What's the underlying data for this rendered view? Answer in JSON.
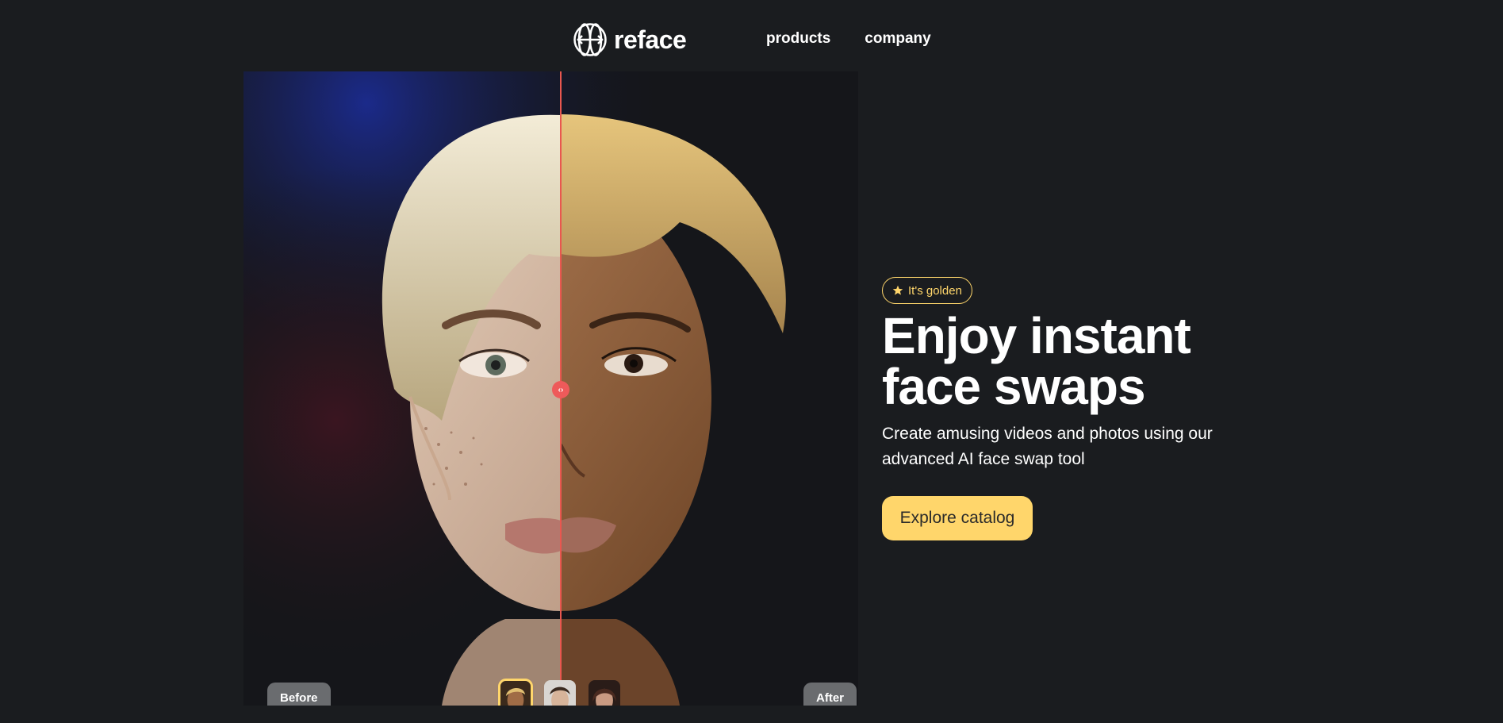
{
  "brand": {
    "name": "reface",
    "logo_icon": "reface-globe-logo-icon"
  },
  "nav": {
    "items": [
      {
        "label": "products"
      },
      {
        "label": "company"
      }
    ]
  },
  "compare": {
    "before_label": "Before",
    "after_label": "After",
    "handle_icon": "split-arrows-icon",
    "thumbnails": [
      {
        "name": "face-thumbnail-1",
        "active": true
      },
      {
        "name": "face-thumbnail-2",
        "active": false
      },
      {
        "name": "face-thumbnail-3",
        "active": false
      }
    ]
  },
  "hero": {
    "badge": {
      "icon": "star-icon",
      "label": "It's golden"
    },
    "headline_line1": "Enjoy instant",
    "headline_line2": "face swaps",
    "subtitle": "Create amusing videos and photos using our advanced AI face swap tool",
    "cta_label": "Explore catalog"
  },
  "colors": {
    "background": "#1a1c1f",
    "accent": "#ffd66b",
    "divider": "#e9574f",
    "label_pill": "#6a6c6f"
  }
}
